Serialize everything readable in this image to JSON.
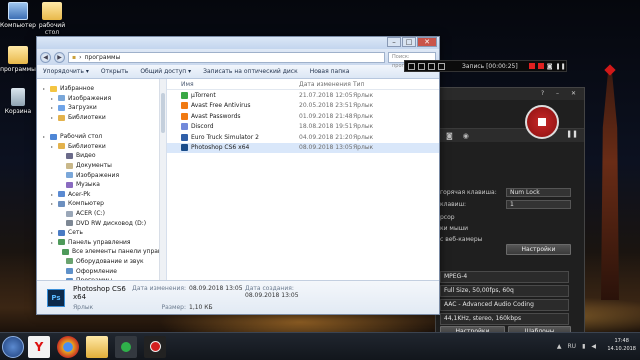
{
  "desktop": {
    "icons": [
      {
        "label": "Компьютер"
      },
      {
        "label": "рабочий стол"
      },
      {
        "label": "программы"
      },
      {
        "label": "Корзина"
      }
    ]
  },
  "explorer": {
    "address": "программы",
    "search_placeholder": "Поиск: программы",
    "toolbar": {
      "organize": "Упорядочить ▾",
      "open": "Открыть",
      "share": "Общий доступ ▾",
      "burn": "Записать на оптический диск",
      "new_folder": "Новая папка"
    },
    "nav": [
      {
        "label": "Избранное",
        "indent": 0
      },
      {
        "label": "Изображения",
        "indent": 1
      },
      {
        "label": "Загрузки",
        "indent": 1
      },
      {
        "label": "Библиотеки",
        "indent": 1
      },
      {
        "label": "",
        "indent": 0
      },
      {
        "label": "Рабочий стол",
        "indent": 0
      },
      {
        "label": "Библиотеки",
        "indent": 1
      },
      {
        "label": "Видео",
        "indent": 2
      },
      {
        "label": "Документы",
        "indent": 2
      },
      {
        "label": "Изображения",
        "indent": 2
      },
      {
        "label": "Музыка",
        "indent": 2
      },
      {
        "label": "Acer-Pk",
        "indent": 1
      },
      {
        "label": "Компьютер",
        "indent": 1
      },
      {
        "label": "ACER (C:)",
        "indent": 2
      },
      {
        "label": "DVD RW дисковод (D:)",
        "indent": 2
      },
      {
        "label": "Сеть",
        "indent": 1
      },
      {
        "label": "Панель управления",
        "indent": 1
      },
      {
        "label": "Все элементы панели управления",
        "indent": 2
      },
      {
        "label": "Оборудование и звук",
        "indent": 2
      },
      {
        "label": "Оформление",
        "indent": 2
      },
      {
        "label": "Программы",
        "indent": 2
      }
    ],
    "columns": {
      "name": "Имя",
      "date": "Дата изменения",
      "type": "Тип"
    },
    "files": [
      {
        "name": "µTorrent",
        "date": "21.07.2018 12:05",
        "type": "Ярлык",
        "color": "#3aa845"
      },
      {
        "name": "Avast Free Antivirus",
        "date": "20.05.2018 23:51",
        "type": "Ярлык",
        "color": "#f07a12"
      },
      {
        "name": "Avast Passwords",
        "date": "01.09.2018 21:48",
        "type": "Ярлык",
        "color": "#f07a12"
      },
      {
        "name": "Discord",
        "date": "18.08.2018 19:51",
        "type": "Ярлык",
        "color": "#7289da"
      },
      {
        "name": "Euro Truck Simulator 2",
        "date": "04.09.2018 21:20",
        "type": "Ярлык",
        "color": "#2f5fa8"
      },
      {
        "name": "Photoshop CS6 x64",
        "date": "08.09.2018 13:05",
        "type": "Ярлык",
        "color": "#1a4c8a"
      }
    ],
    "details": {
      "name": "Photoshop CS6 x64",
      "type": "Ярлык",
      "modified_label": "Дата изменения:",
      "modified_value": "08.09.2018 13:05",
      "created_label": "Дата создания:",
      "created_value": "08.09.2018 13:05",
      "size_label": "Размер:",
      "size_value": "1,10 КБ",
      "icon_text": "Ps"
    }
  },
  "recorder_bar": {
    "status": "Запись [00:00:25]"
  },
  "recorder": {
    "hotkey_label": "горячая клавиша:",
    "hotkey_value": "Num Lock",
    "key_label": "клавиш:",
    "key_value": "1",
    "cursor_label": "рсор",
    "mouse_label": "ки мыши",
    "webcam_label": "с веб-камеры",
    "settings_btn": "Настройки",
    "codec": "MPEG-4",
    "video_info": "Full Size, 50,00fps, 60q",
    "audio_codec": "AAC - Advanced Audio Coding",
    "audio_info": "44,1KHz, stereo, 160kbps",
    "bottom_settings": "Настройки",
    "templates": "Шаблоны"
  },
  "taskbar": {
    "time": "17:48",
    "date": "14.10.2018",
    "lang": "RU"
  }
}
